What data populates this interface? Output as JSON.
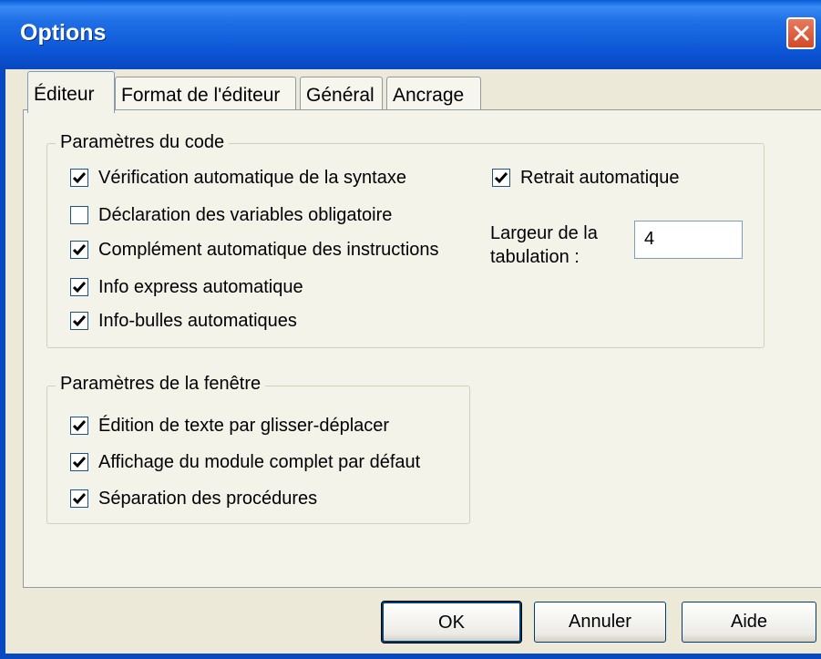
{
  "window": {
    "title": "Options"
  },
  "tabs": [
    {
      "label": "Éditeur",
      "active": true
    },
    {
      "label": "Format de l'éditeur",
      "active": false
    },
    {
      "label": "Général",
      "active": false
    },
    {
      "label": "Ancrage",
      "active": false
    }
  ],
  "code_group": {
    "legend": "Paramètres du code",
    "options": [
      {
        "label": "Vérification automatique de la syntaxe",
        "checked": true
      },
      {
        "label": "Déclaration des variables obligatoire",
        "checked": false
      },
      {
        "label": "Complément automatique des instructions",
        "checked": true
      },
      {
        "label": "Info express automatique",
        "checked": true
      },
      {
        "label": "Info-bulles automatiques",
        "checked": true
      }
    ],
    "auto_indent": {
      "label": "Retrait automatique",
      "checked": true
    },
    "tab_width": {
      "label_line1": "Largeur de la",
      "label_line2": "tabulation :",
      "value": "4"
    }
  },
  "window_group": {
    "legend": "Paramètres de la fenêtre",
    "options": [
      {
        "label": "Édition de texte par glisser-déplacer",
        "checked": true
      },
      {
        "label": "Affichage du module complet par défaut",
        "checked": true
      },
      {
        "label": "Séparation des procédures",
        "checked": true
      }
    ]
  },
  "buttons": {
    "ok": "OK",
    "cancel": "Annuler",
    "help": "Aide"
  },
  "colors": {
    "titlebar": "#0c55d6",
    "dialog_bg": "#ece9d8",
    "close_button": "#d2492a"
  }
}
